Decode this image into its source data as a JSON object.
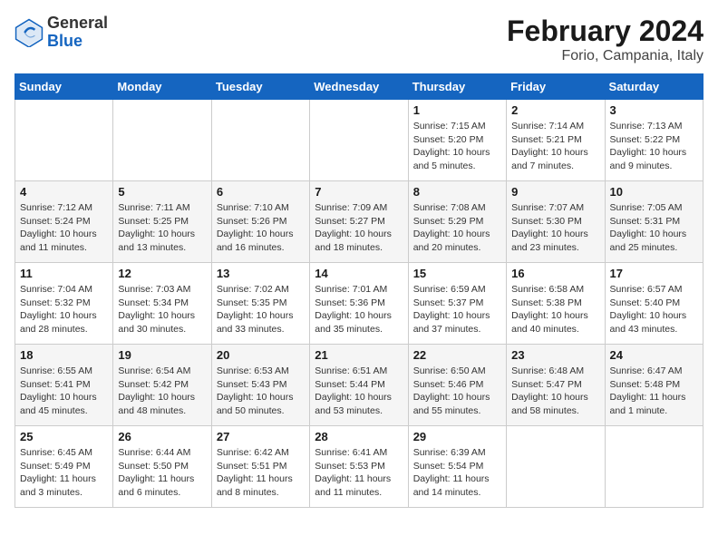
{
  "header": {
    "logo_general": "General",
    "logo_blue": "Blue",
    "title": "February 2024",
    "subtitle": "Forio, Campania, Italy"
  },
  "columns": [
    "Sunday",
    "Monday",
    "Tuesday",
    "Wednesday",
    "Thursday",
    "Friday",
    "Saturday"
  ],
  "weeks": [
    [
      {
        "day": "",
        "info": ""
      },
      {
        "day": "",
        "info": ""
      },
      {
        "day": "",
        "info": ""
      },
      {
        "day": "",
        "info": ""
      },
      {
        "day": "1",
        "info": "Sunrise: 7:15 AM\nSunset: 5:20 PM\nDaylight: 10 hours\nand 5 minutes."
      },
      {
        "day": "2",
        "info": "Sunrise: 7:14 AM\nSunset: 5:21 PM\nDaylight: 10 hours\nand 7 minutes."
      },
      {
        "day": "3",
        "info": "Sunrise: 7:13 AM\nSunset: 5:22 PM\nDaylight: 10 hours\nand 9 minutes."
      }
    ],
    [
      {
        "day": "4",
        "info": "Sunrise: 7:12 AM\nSunset: 5:24 PM\nDaylight: 10 hours\nand 11 minutes."
      },
      {
        "day": "5",
        "info": "Sunrise: 7:11 AM\nSunset: 5:25 PM\nDaylight: 10 hours\nand 13 minutes."
      },
      {
        "day": "6",
        "info": "Sunrise: 7:10 AM\nSunset: 5:26 PM\nDaylight: 10 hours\nand 16 minutes."
      },
      {
        "day": "7",
        "info": "Sunrise: 7:09 AM\nSunset: 5:27 PM\nDaylight: 10 hours\nand 18 minutes."
      },
      {
        "day": "8",
        "info": "Sunrise: 7:08 AM\nSunset: 5:29 PM\nDaylight: 10 hours\nand 20 minutes."
      },
      {
        "day": "9",
        "info": "Sunrise: 7:07 AM\nSunset: 5:30 PM\nDaylight: 10 hours\nand 23 minutes."
      },
      {
        "day": "10",
        "info": "Sunrise: 7:05 AM\nSunset: 5:31 PM\nDaylight: 10 hours\nand 25 minutes."
      }
    ],
    [
      {
        "day": "11",
        "info": "Sunrise: 7:04 AM\nSunset: 5:32 PM\nDaylight: 10 hours\nand 28 minutes."
      },
      {
        "day": "12",
        "info": "Sunrise: 7:03 AM\nSunset: 5:34 PM\nDaylight: 10 hours\nand 30 minutes."
      },
      {
        "day": "13",
        "info": "Sunrise: 7:02 AM\nSunset: 5:35 PM\nDaylight: 10 hours\nand 33 minutes."
      },
      {
        "day": "14",
        "info": "Sunrise: 7:01 AM\nSunset: 5:36 PM\nDaylight: 10 hours\nand 35 minutes."
      },
      {
        "day": "15",
        "info": "Sunrise: 6:59 AM\nSunset: 5:37 PM\nDaylight: 10 hours\nand 37 minutes."
      },
      {
        "day": "16",
        "info": "Sunrise: 6:58 AM\nSunset: 5:38 PM\nDaylight: 10 hours\nand 40 minutes."
      },
      {
        "day": "17",
        "info": "Sunrise: 6:57 AM\nSunset: 5:40 PM\nDaylight: 10 hours\nand 43 minutes."
      }
    ],
    [
      {
        "day": "18",
        "info": "Sunrise: 6:55 AM\nSunset: 5:41 PM\nDaylight: 10 hours\nand 45 minutes."
      },
      {
        "day": "19",
        "info": "Sunrise: 6:54 AM\nSunset: 5:42 PM\nDaylight: 10 hours\nand 48 minutes."
      },
      {
        "day": "20",
        "info": "Sunrise: 6:53 AM\nSunset: 5:43 PM\nDaylight: 10 hours\nand 50 minutes."
      },
      {
        "day": "21",
        "info": "Sunrise: 6:51 AM\nSunset: 5:44 PM\nDaylight: 10 hours\nand 53 minutes."
      },
      {
        "day": "22",
        "info": "Sunrise: 6:50 AM\nSunset: 5:46 PM\nDaylight: 10 hours\nand 55 minutes."
      },
      {
        "day": "23",
        "info": "Sunrise: 6:48 AM\nSunset: 5:47 PM\nDaylight: 10 hours\nand 58 minutes."
      },
      {
        "day": "24",
        "info": "Sunrise: 6:47 AM\nSunset: 5:48 PM\nDaylight: 11 hours\nand 1 minute."
      }
    ],
    [
      {
        "day": "25",
        "info": "Sunrise: 6:45 AM\nSunset: 5:49 PM\nDaylight: 11 hours\nand 3 minutes."
      },
      {
        "day": "26",
        "info": "Sunrise: 6:44 AM\nSunset: 5:50 PM\nDaylight: 11 hours\nand 6 minutes."
      },
      {
        "day": "27",
        "info": "Sunrise: 6:42 AM\nSunset: 5:51 PM\nDaylight: 11 hours\nand 8 minutes."
      },
      {
        "day": "28",
        "info": "Sunrise: 6:41 AM\nSunset: 5:53 PM\nDaylight: 11 hours\nand 11 minutes."
      },
      {
        "day": "29",
        "info": "Sunrise: 6:39 AM\nSunset: 5:54 PM\nDaylight: 11 hours\nand 14 minutes."
      },
      {
        "day": "",
        "info": ""
      },
      {
        "day": "",
        "info": ""
      }
    ]
  ]
}
